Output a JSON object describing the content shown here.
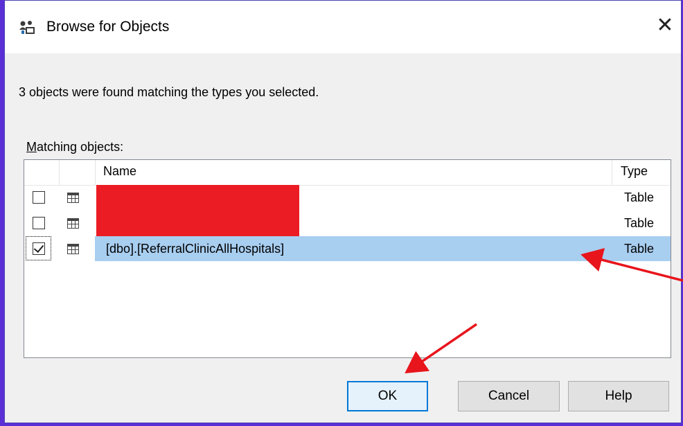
{
  "dialog": {
    "title": "Browse for Objects",
    "close_glyph": "✕",
    "message": "3 objects were found matching the types you selected.",
    "matching_label_underline": "M",
    "matching_label_rest": "atching objects:"
  },
  "list": {
    "columns": {
      "name": "Name",
      "type": "Type"
    },
    "rows": [
      {
        "checked": false,
        "name": "",
        "type": "Table",
        "redacted": true
      },
      {
        "checked": false,
        "name": "",
        "type": "Table",
        "redacted": true
      },
      {
        "checked": true,
        "name": "[dbo].[ReferralClinicAllHospitals]",
        "type": "Table",
        "selected": true
      }
    ]
  },
  "buttons": {
    "ok": "OK",
    "cancel": "Cancel",
    "help": "Help"
  },
  "colors": {
    "selection": "#a8cef0",
    "redaction": "#ec1c24",
    "annotation_arrow": "#e8151c",
    "background": "#5b2fd6"
  },
  "icons": [
    "browse-objects-icon",
    "close-icon",
    "table-icon",
    "checkbox-checked-icon"
  ]
}
